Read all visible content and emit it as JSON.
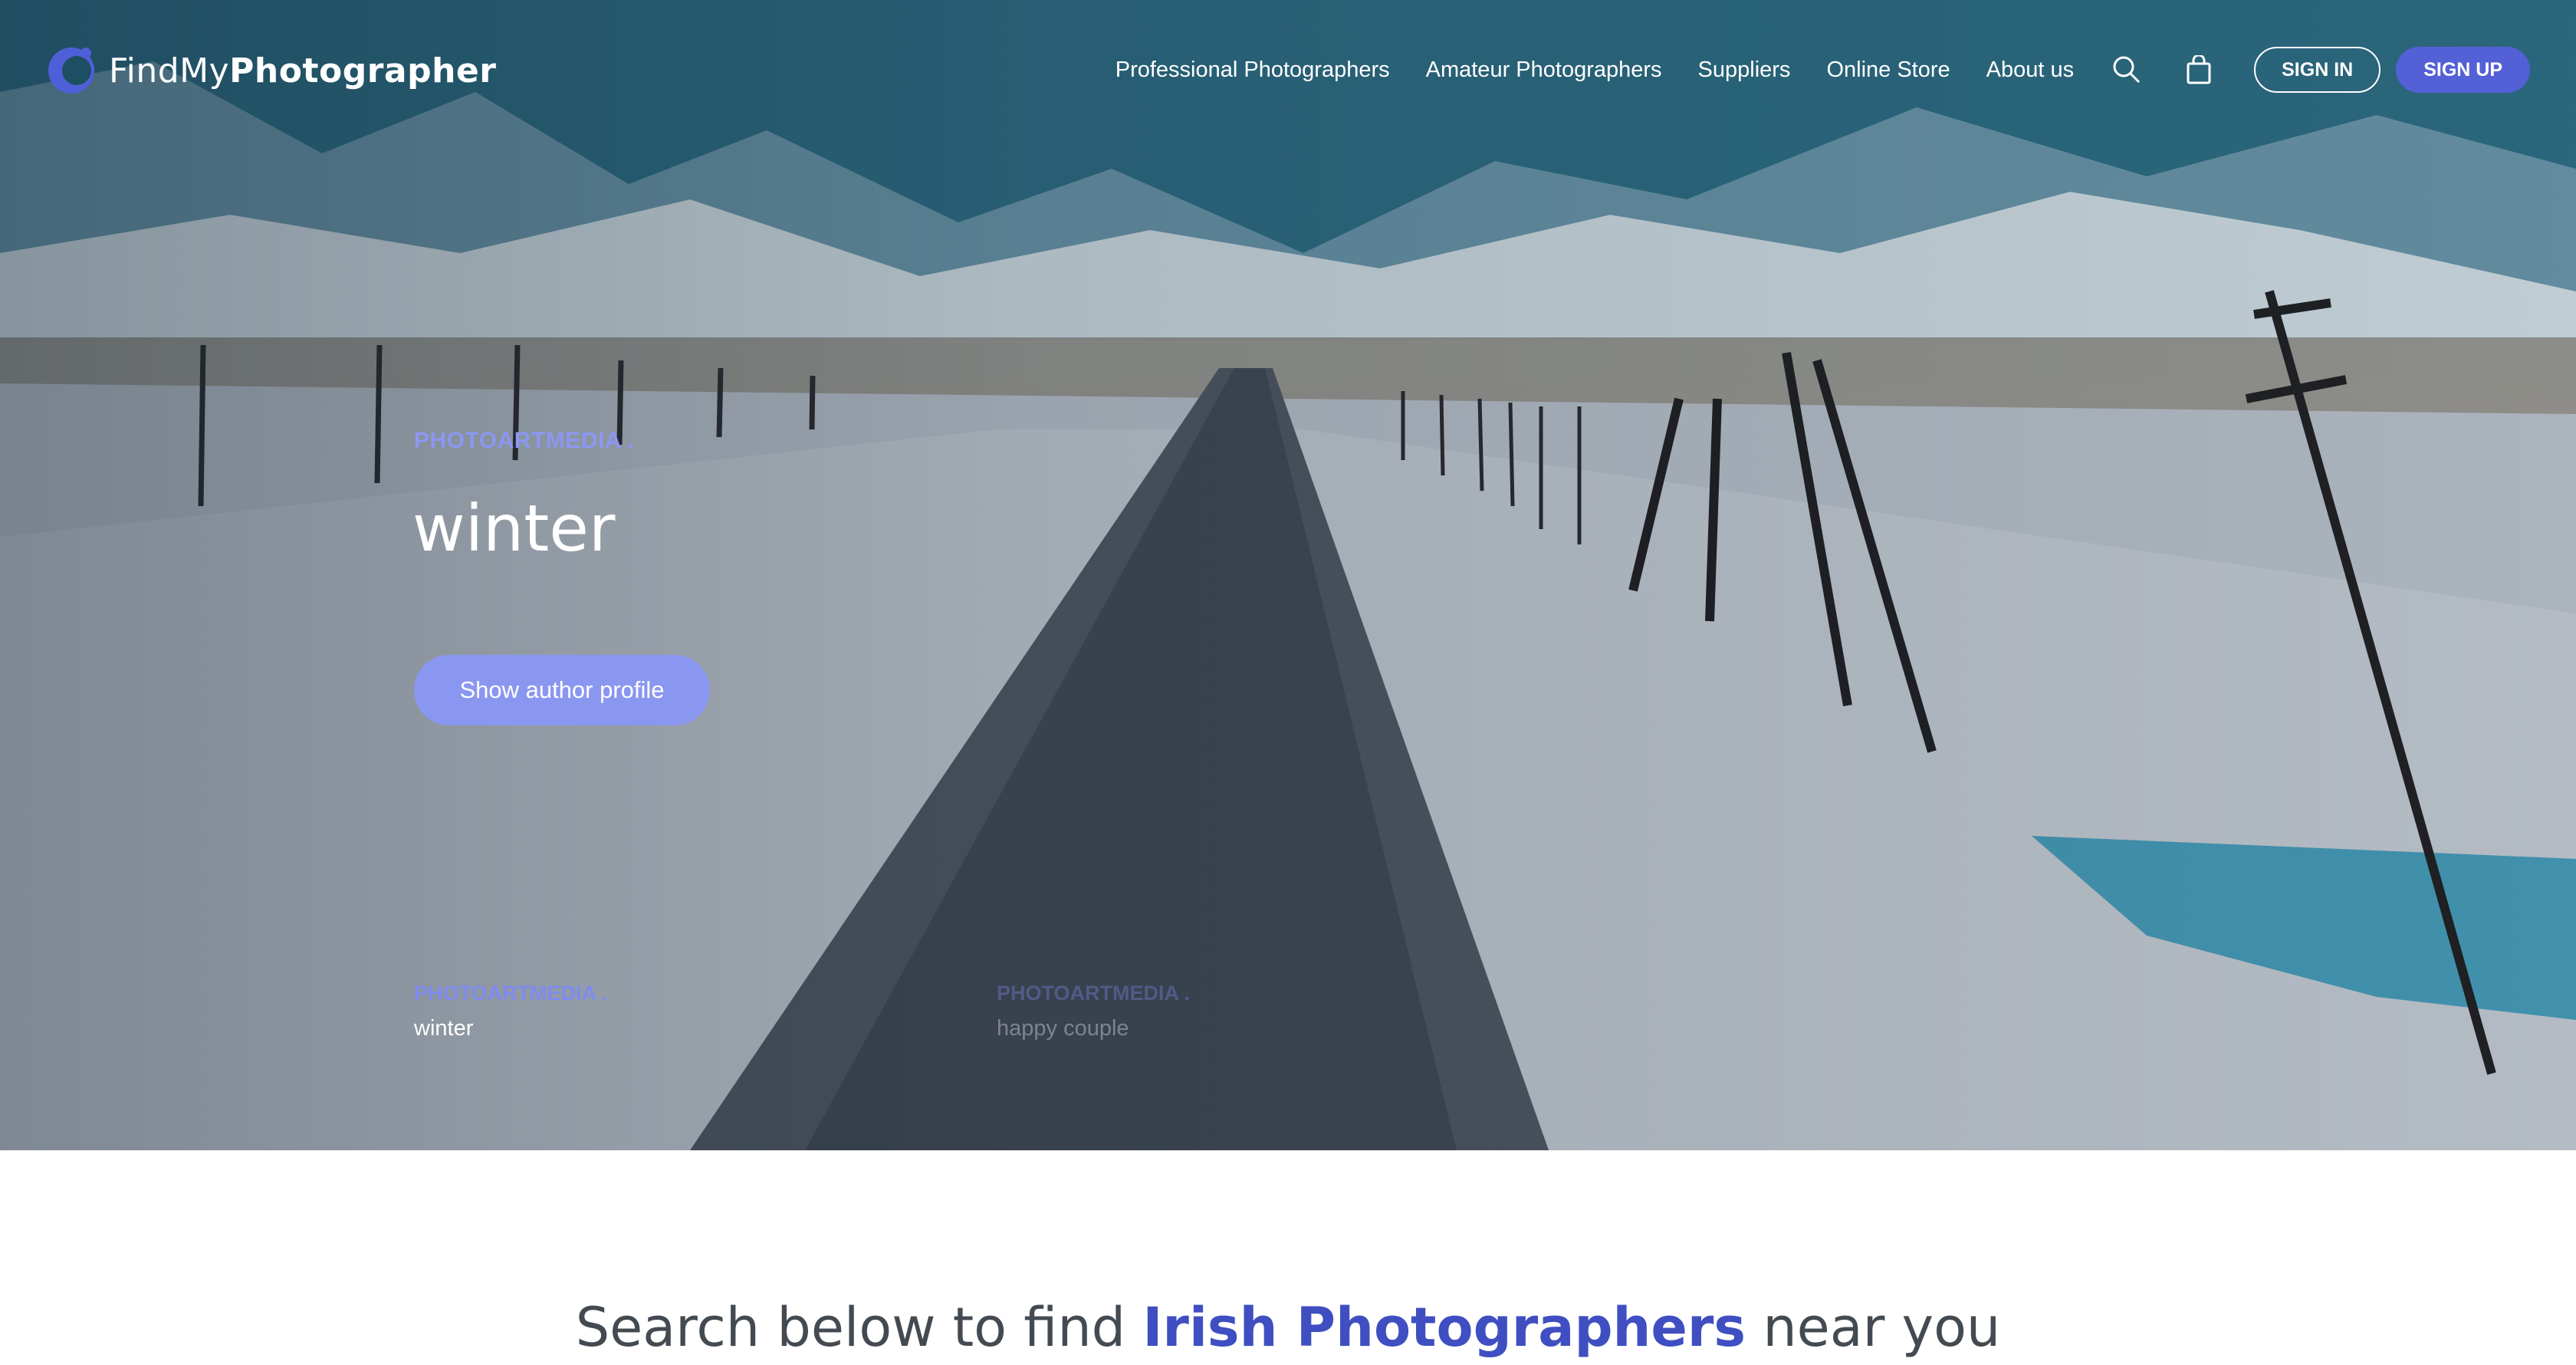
{
  "brand": {
    "name_regular": "FindMy",
    "name_bold": "Photographer",
    "logo_icon": "crescent-c-logo"
  },
  "nav": {
    "links": [
      {
        "label": "Professional Photographers"
      },
      {
        "label": "Amateur Photographers"
      },
      {
        "label": "Suppliers"
      },
      {
        "label": "Online Store"
      },
      {
        "label": "About us"
      }
    ],
    "search_icon": "search-icon",
    "cart_icon": "shopping-bag-icon",
    "sign_in": "SIGN IN",
    "sign_up": "SIGN UP"
  },
  "slide": {
    "author": "PHOTOARTMEDIA .",
    "title": "winter",
    "profile_button": "Show author profile"
  },
  "thumbnails": [
    {
      "author": "PHOTOARTMEDIA .",
      "title": "winter",
      "active": true
    },
    {
      "author": "PHOTOARTMEDIA .",
      "title": "happy couple",
      "active": false
    }
  ],
  "search": {
    "prefix": "Search below to find ",
    "highlight": "Irish Photographers",
    "suffix": " near you"
  },
  "colors": {
    "accent": "#5360d6",
    "accent_light": "#8a97f0",
    "heading_highlight": "#3f4fc1"
  }
}
